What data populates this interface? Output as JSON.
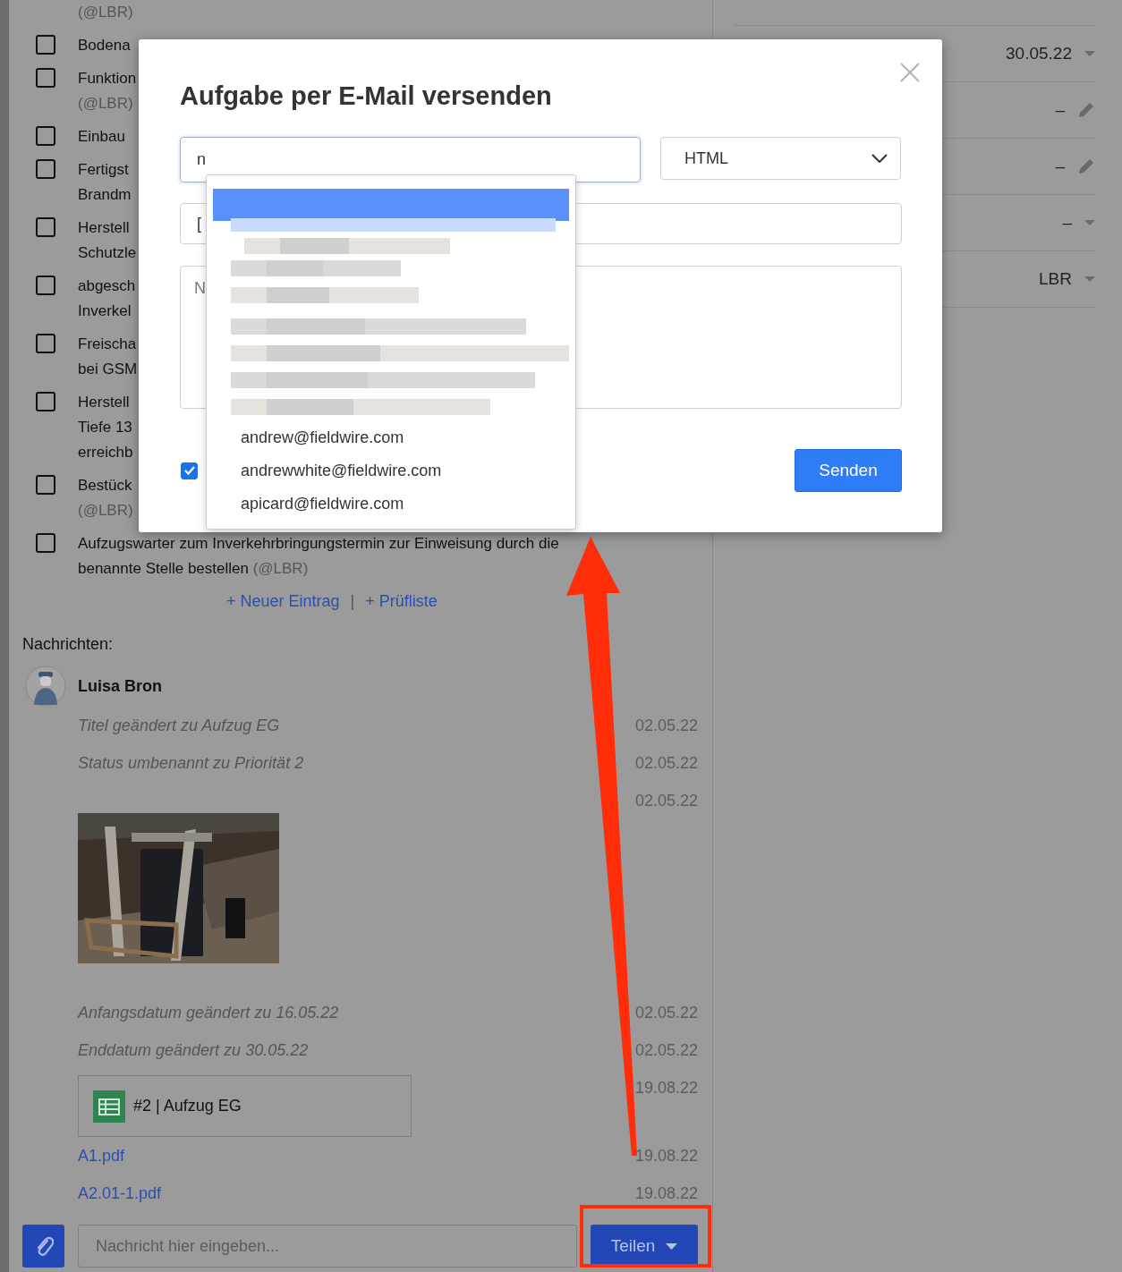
{
  "checklist": {
    "items": [
      {
        "kind": "continuation",
        "tag": "(@LBR)"
      },
      {
        "kind": "checkbox",
        "checked": false,
        "lines": [
          "Bodena"
        ]
      },
      {
        "kind": "checkbox",
        "checked": false,
        "lines": [
          "Funktion"
        ],
        "tag": "(@LBR)",
        "tag_inline": false
      },
      {
        "kind": "checkbox",
        "checked": false,
        "lines": [
          "Einbau"
        ]
      },
      {
        "kind": "checkbox",
        "checked": false,
        "lines": [
          "Fertigst",
          "Brandm"
        ]
      },
      {
        "kind": "checkbox",
        "checked": false,
        "lines": [
          "Herstell",
          "Schutzle"
        ]
      },
      {
        "kind": "checkbox",
        "checked": false,
        "lines": [
          "abgesch",
          "Inverkel"
        ]
      },
      {
        "kind": "checkbox",
        "checked": false,
        "lines": [
          "Freischa",
          "bei GSM"
        ]
      },
      {
        "kind": "checkbox",
        "checked": false,
        "lines": [
          "Herstell",
          "Tiefe 13",
          "erreichb"
        ]
      },
      {
        "kind": "checkbox",
        "checked": false,
        "lines": [
          "Bestück"
        ],
        "tag": "(@LBR)",
        "tag_inline": false
      },
      {
        "kind": "checkbox",
        "checked": false,
        "lines": [
          "Aufzugswarter zum Inverkehrbringungstermin zur Einweisung durch die",
          "benannte Stelle bestellen"
        ],
        "tag": "(@LBR)",
        "tag_inline": true
      }
    ],
    "actions": [
      "+ Neuer Eintrag",
      "+ Prüfliste"
    ],
    "action_separator": "|"
  },
  "messages": {
    "label": "Nachrichten:",
    "author": "Luisa Bron",
    "entries": [
      {
        "kind": "text",
        "text": "Titel geändert zu Aufzug EG",
        "date": "02.05.22"
      },
      {
        "kind": "text",
        "text": "Status umbenannt zu Priorität 2",
        "date": "02.05.22"
      },
      {
        "date": "02.05.22"
      },
      {
        "kind": "text",
        "text": "Anfangsdatum geändert zu 16.05.22",
        "date": "02.05.22"
      },
      {
        "kind": "text",
        "text": "Enddatum geändert zu 30.05.22",
        "date": "02.05.22"
      },
      {
        "kind": "card",
        "text": "#2 | Aufzug EG",
        "date": "19.08.22"
      },
      {
        "kind": "link",
        "text": "A1.pdf",
        "date": "19.08.22"
      },
      {
        "kind": "link",
        "text": "A2.01-1.pdf",
        "date": "19.08.22"
      }
    ]
  },
  "composer": {
    "placeholder": "Nachricht hier eingeben...",
    "share_button": "Teilen"
  },
  "details": {
    "rows": [
      {
        "value": "30.05.22",
        "kind": "caret"
      },
      {
        "value": "–",
        "kind": "pencil"
      },
      {
        "value": "–",
        "kind": "pencil"
      },
      {
        "value": "–",
        "kind": "caret"
      },
      {
        "value": "LBR",
        "kind": "caret"
      }
    ]
  },
  "dialog": {
    "title": "Aufgabe per E-Mail versenden",
    "recipient": {
      "value": "n"
    },
    "format": {
      "value": "HTML"
    },
    "subject": {
      "value": "["
    },
    "message": {
      "placeholder": "N"
    },
    "copy_checkbox": {
      "checked": true
    },
    "send_button": "Senden",
    "suggestions": {
      "redacted": true,
      "items": [
        {
          "text": "andrew@fieldwire.com",
          "selected": false
        },
        {
          "text": "andrewwhite@fieldwire.com",
          "selected": false
        },
        {
          "text": "apicard@fieldwire.com",
          "selected": false
        }
      ]
    }
  }
}
